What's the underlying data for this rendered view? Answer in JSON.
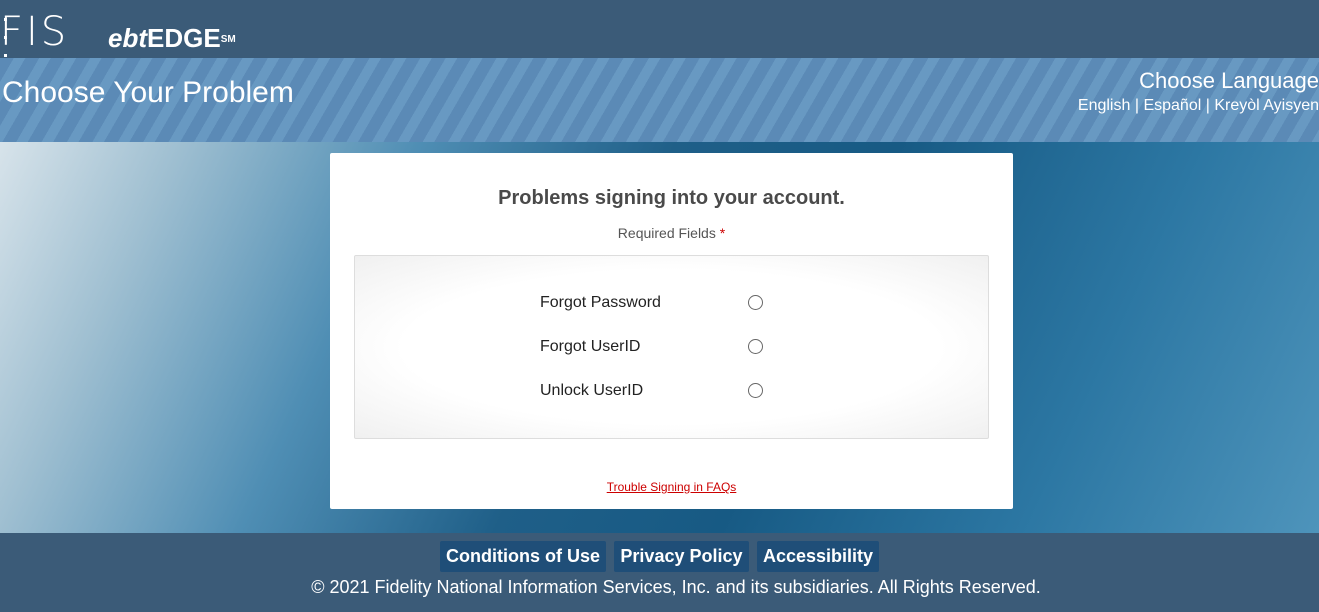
{
  "header": {
    "logo_fis": "FIS",
    "logo_ebt": "ebt",
    "logo_edge": "EDGE",
    "logo_sm": "SM"
  },
  "titlebar": {
    "page_title": "Choose Your Problem",
    "language_title": "Choose Language",
    "languages": [
      "English",
      "Español",
      "Kreyòl Ayisyen"
    ],
    "separator": "|"
  },
  "card": {
    "title": "Problems signing into your account.",
    "required_label": "Required Fields",
    "required_star": "*",
    "options": [
      {
        "label": "Forgot Password",
        "selected": false
      },
      {
        "label": "Forgot UserID",
        "selected": false
      },
      {
        "label": "Unlock UserID",
        "selected": false
      }
    ],
    "faq_link": "Trouble Signing in FAQs"
  },
  "footer": {
    "links": [
      "Conditions of Use",
      "Privacy Policy",
      "Accessibility"
    ],
    "copyright": "© 2021 Fidelity National Information Services, Inc. and its subsidiaries. All Rights Reserved."
  },
  "colors": {
    "header_bg": "#3b5b78",
    "accent_red": "#cc0000",
    "footer_button": "#1f4e78"
  }
}
